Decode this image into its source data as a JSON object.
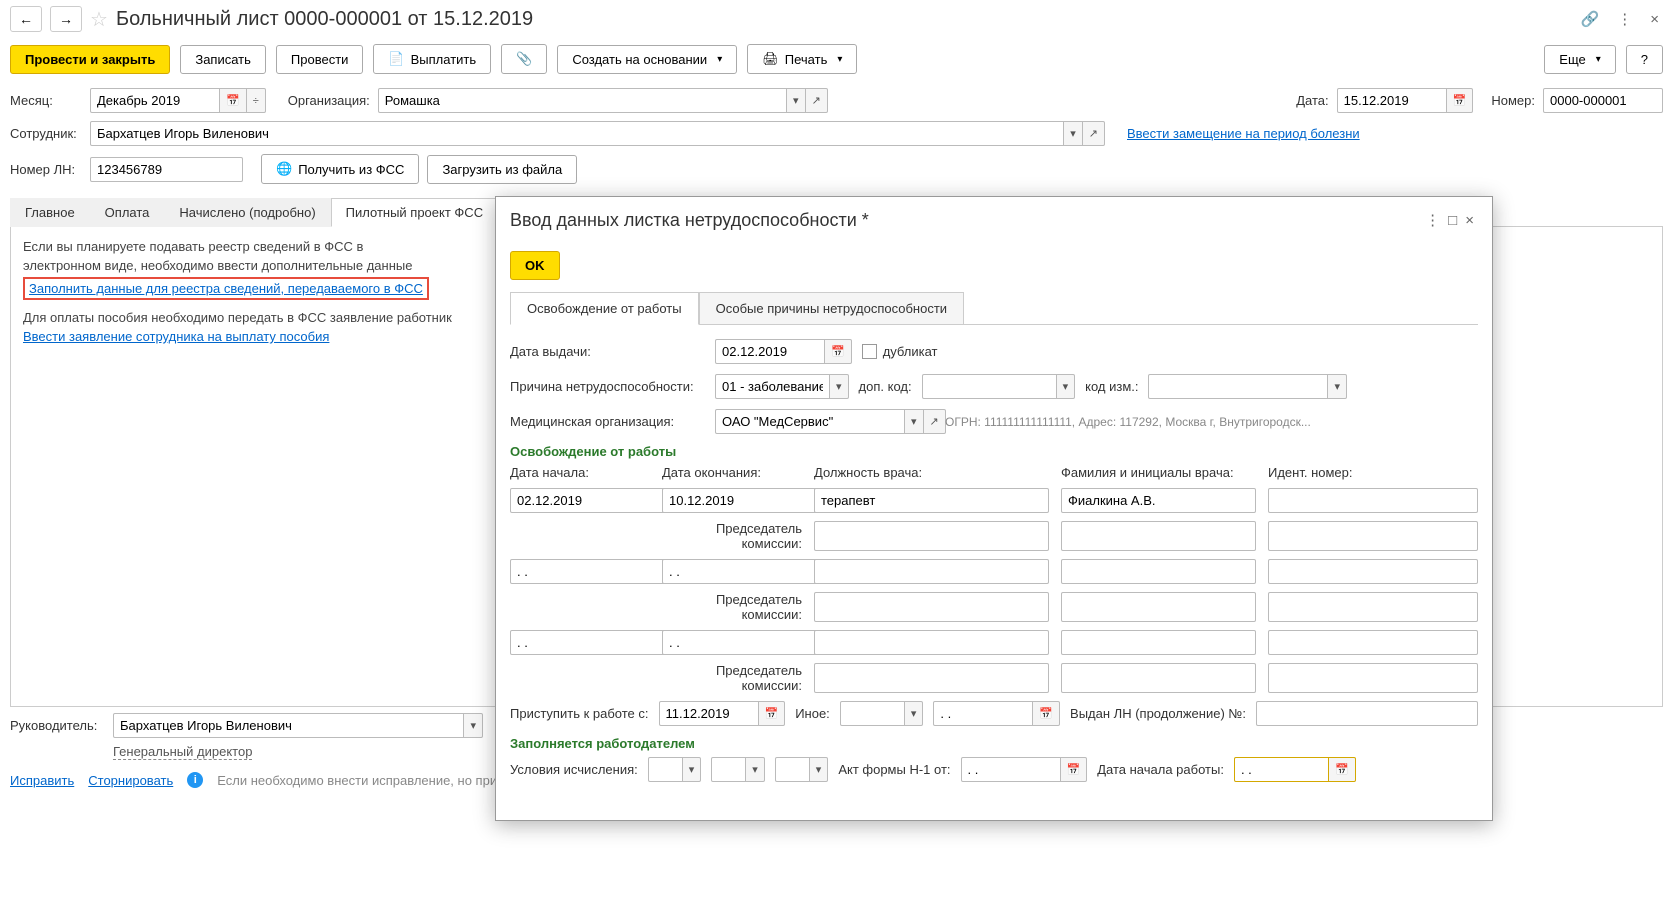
{
  "nav": {
    "back": "←",
    "forward": "→"
  },
  "title": "Больничный лист 0000-000001 от 15.12.2019",
  "title_icons": {
    "link": "🔗",
    "more": "⋮",
    "close": "×"
  },
  "buttons": {
    "post_close": "Провести и закрыть",
    "record": "Записать",
    "post": "Провести",
    "pay": "Выплатить",
    "attach": "📎",
    "create_base": "Создать на основании",
    "print": "Печать",
    "more": "Еще",
    "help": "?"
  },
  "row1": {
    "month_label": "Месяц:",
    "month_value": "Декабрь 2019",
    "org_label": "Организация:",
    "org_value": "Ромашка",
    "date_label": "Дата:",
    "date_value": "15.12.2019",
    "num_label": "Номер:",
    "num_value": "0000-000001"
  },
  "row2": {
    "emp_label": "Сотрудник:",
    "emp_value": "Бархатцев Игорь Виленович",
    "sub_link": "Ввести замещение на период болезни"
  },
  "row3": {
    "ln_label": "Номер ЛН:",
    "ln_value": "123456789",
    "fss_btn": "Получить из ФСС",
    "load_btn": "Загрузить из файла"
  },
  "tabs": {
    "t1": "Главное",
    "t2": "Оплата",
    "t3": "Начислено (подробно)",
    "t4": "Пилотный проект ФСС"
  },
  "tab_content": {
    "info1": "Если вы планируете подавать реестр сведений в ФСС в",
    "info2": "электронном виде, необходимо ввести дополнительные данные",
    "link1": "Заполнить данные для реестра сведений, передаваемого в ФСС",
    "info3": "Для оплаты пособия необходимо передать в ФСС заявление работник",
    "link2": "Ввести заявление сотрудника на выплату пособия"
  },
  "footer": {
    "mgr_label": "Руководитель:",
    "mgr_value": "Бархатцев Игорь Виленович",
    "mgr_pos": "Генеральный директор",
    "fix": "Исправить",
    "reverse": "Сторнировать",
    "info": "Если необходимо внести исправление, но при этом сохранить данный экземпляр документа, воспользуйтесь командой Исправить или Сторнировать"
  },
  "modal": {
    "title": "Ввод данных листка нетрудоспособности *",
    "icons": {
      "more": "⋮",
      "max": "□",
      "close": "×"
    },
    "ok": "OK",
    "tabs": {
      "t1": "Освобождение от работы",
      "t2": "Особые причины нетрудоспособности"
    },
    "issue_date_label": "Дата выдачи:",
    "issue_date": "02.12.2019",
    "duplicate": "дубликат",
    "reason_label": "Причина нетрудоспособности:",
    "reason_value": "01 - заболевание",
    "add_code_label": "доп. код:",
    "code_change_label": "код изм.:",
    "med_org_label": "Медицинская организация:",
    "med_org_value": "ОАО \"МедСервис\"",
    "med_info": "ОГРН: 111111111111111, Адрес: 117292, Москва г, Внутригородск...",
    "section1": "Освобождение от работы",
    "col_start": "Дата начала:",
    "col_end": "Дата окончания:",
    "col_doc": "Должность врача:",
    "col_name": "Фамилия и инициалы врача:",
    "col_id": "Идент. номер:",
    "start1": "02.12.2019",
    "end1": "10.12.2019",
    "doc1": "терапевт",
    "name1": "Фиалкина А.В.",
    "chair_label": "Председатель комиссии:",
    "dots": ". .",
    "work_from_label": "Приступить к работе с:",
    "work_from": "11.12.2019",
    "other_label": "Иное:",
    "issued_ln_label": "Выдан ЛН (продолжение) №:",
    "section2": "Заполняется работодателем",
    "calc_cond_label": "Условия исчисления:",
    "act_label": "Акт формы Н-1 от:",
    "start_work_label": "Дата начала работы:"
  }
}
